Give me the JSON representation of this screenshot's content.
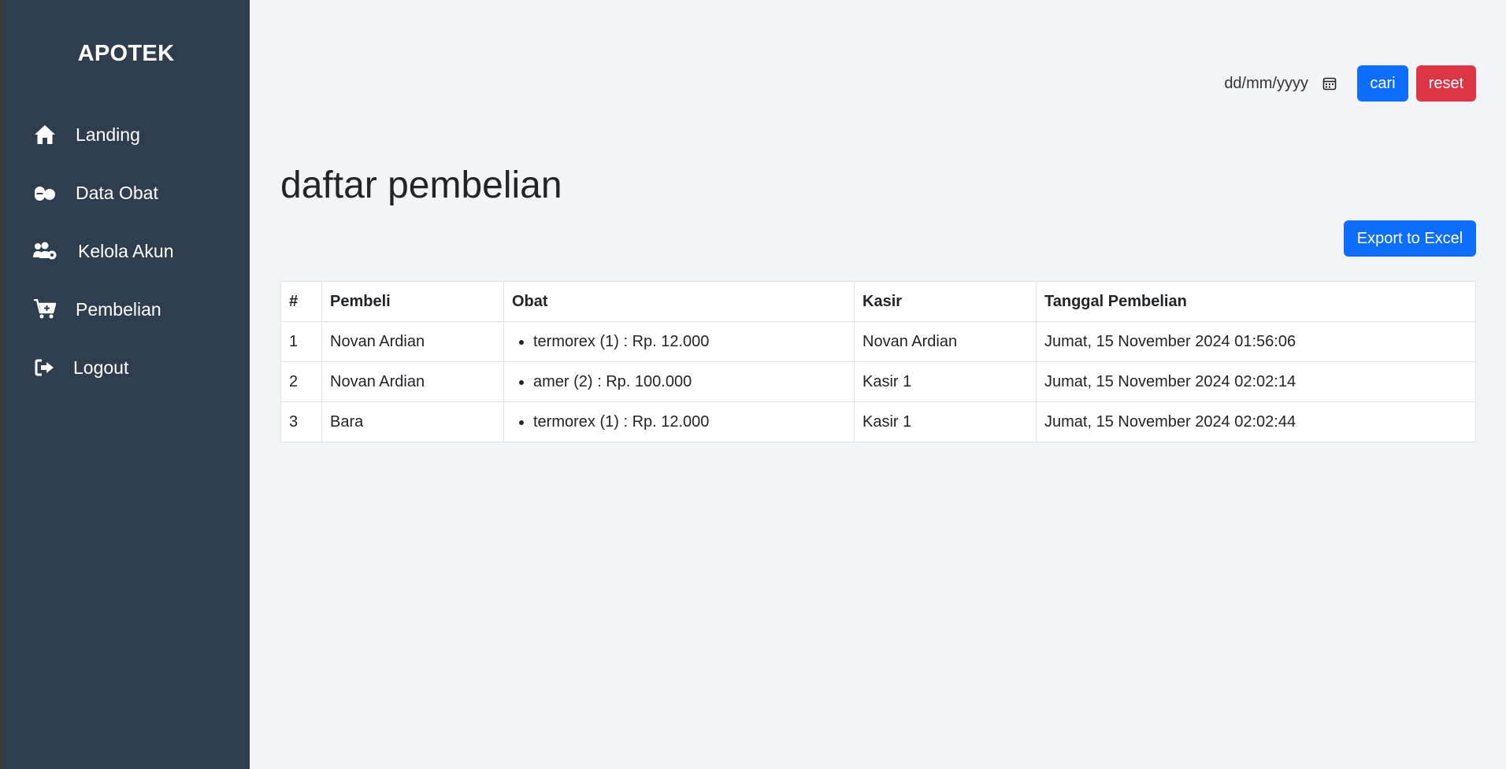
{
  "sidebar": {
    "brand": "APOTEK",
    "items": [
      {
        "label": "Landing",
        "icon": "home-icon"
      },
      {
        "label": "Data Obat",
        "icon": "pills-icon"
      },
      {
        "label": "Kelola Akun",
        "icon": "users-gear-icon"
      },
      {
        "label": "Pembelian",
        "icon": "cart-plus-icon"
      },
      {
        "label": "Logout",
        "icon": "logout-icon"
      }
    ]
  },
  "filter": {
    "date_placeholder": "dd/mm/yyyy",
    "search_label": "cari",
    "reset_label": "reset"
  },
  "main": {
    "title": "daftar pembelian",
    "export_label": "Export to Excel"
  },
  "table": {
    "headers": [
      "#",
      "Pembeli",
      "Obat",
      "Kasir",
      "Tanggal Pembelian"
    ],
    "rows": [
      {
        "no": "1",
        "pembeli": "Novan Ardian",
        "obat": "termorex (1) : Rp. 12.000",
        "kasir": "Novan Ardian",
        "tanggal": "Jumat, 15 November 2024 01:56:06"
      },
      {
        "no": "2",
        "pembeli": "Novan Ardian",
        "obat": "amer (2) : Rp. 100.000",
        "kasir": "Kasir 1",
        "tanggal": "Jumat, 15 November 2024 02:02:14"
      },
      {
        "no": "3",
        "pembeli": "Bara",
        "obat": "termorex (1) : Rp. 12.000",
        "kasir": "Kasir 1",
        "tanggal": "Jumat, 15 November 2024 02:02:44"
      }
    ]
  },
  "colors": {
    "sidebar_bg": "#2f3e4e",
    "primary": "#0d6efd",
    "danger": "#dc3545",
    "page_bg": "#f3f4f7"
  }
}
